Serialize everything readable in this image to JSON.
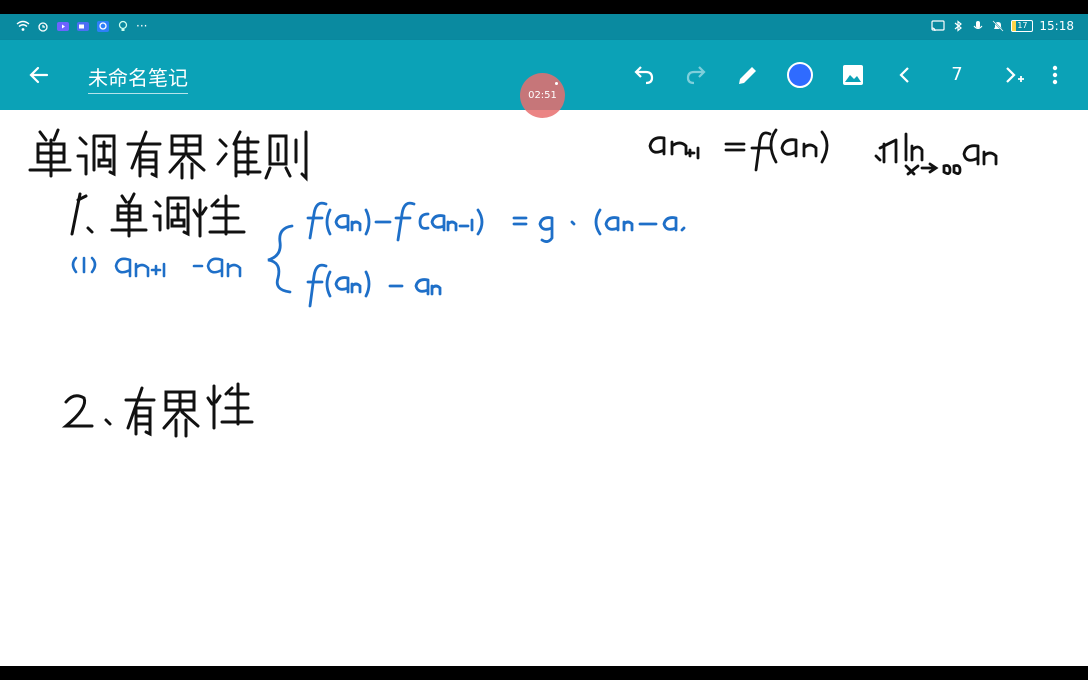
{
  "status": {
    "time": "15:18",
    "battery": "17",
    "more": "···"
  },
  "toolbar": {
    "title": "未命名笔记",
    "page_number": "7",
    "pen_color": "#2f6bff",
    "icons": [
      "back-arrow-icon",
      "undo-icon",
      "redo-icon",
      "pen-icon",
      "color-dot",
      "image-icon",
      "prev-page-icon",
      "next-page-add-icon",
      "more-vert-icon"
    ]
  },
  "timer": {
    "text": "02:51"
  },
  "note": {
    "heading": "单调有界准则",
    "formula": "a_{n+1} = f(a_n) , lim_{n→∞} a_n",
    "item1": "1. 单调性",
    "item1_sub": "(1) a_{n+1} - a_n",
    "brace_line1": "f(a_n) - f(a_{n-1}) = g · (a_n - a",
    "brace_line2": "f(a_n) - a_n",
    "item2": "2. 有界性",
    "ink_black": "#111111",
    "ink_blue": "#1e6fc8"
  }
}
